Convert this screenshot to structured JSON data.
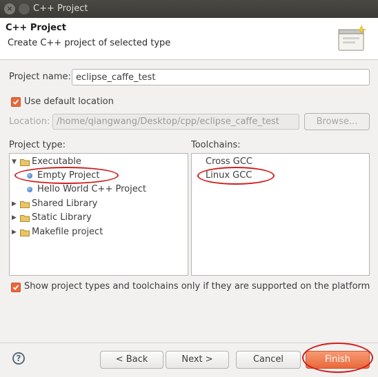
{
  "window": {
    "title": "C++ Project"
  },
  "header": {
    "title": "C++ Project",
    "subtitle": "Create C++ project of selected type",
    "icon": "wizard-banner-icon"
  },
  "project_name": {
    "label": "Project name:",
    "value": "eclipse_caffe_test"
  },
  "default_location": {
    "checked": true,
    "label": "Use default location"
  },
  "location": {
    "label": "Location:",
    "value": "/home/qiangwang/Desktop/cpp/eclipse_caffe_test",
    "browse_label": "Browse..."
  },
  "project_type": {
    "label": "Project type:",
    "items": [
      {
        "label": "Executable",
        "expanded": true,
        "icon": "folder-icon",
        "level": 0
      },
      {
        "label": "Empty Project",
        "icon": "dot-icon",
        "level": 1,
        "selected": true
      },
      {
        "label": "Hello World C++ Project",
        "icon": "dot-icon",
        "level": 1
      },
      {
        "label": "Shared Library",
        "expanded": false,
        "icon": "folder-icon",
        "level": 0
      },
      {
        "label": "Static Library",
        "expanded": false,
        "icon": "folder-icon",
        "level": 0
      },
      {
        "label": "Makefile project",
        "expanded": false,
        "icon": "folder-icon",
        "level": 0
      }
    ]
  },
  "toolchains": {
    "label": "Toolchains:",
    "items": [
      {
        "label": "Cross GCC"
      },
      {
        "label": "Linux GCC",
        "selected": true
      }
    ]
  },
  "filter": {
    "checked": true,
    "label": "Show project types and toolchains only if they are supported on the platform"
  },
  "buttons": {
    "back": "< Back",
    "next": "Next >",
    "cancel": "Cancel",
    "finish": "Finish"
  },
  "colors": {
    "accent": "#e9683b",
    "annotation": "#d11d1d"
  }
}
